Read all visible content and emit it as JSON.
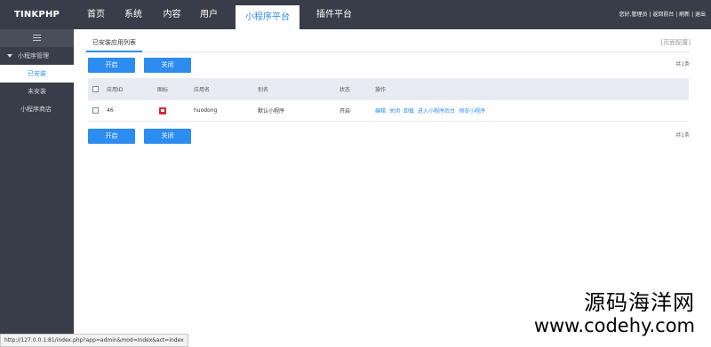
{
  "app": {
    "logo": "TINKPHP"
  },
  "nav": {
    "items": [
      {
        "label": "首页"
      },
      {
        "label": "系统"
      },
      {
        "label": "内容"
      },
      {
        "label": "用户"
      },
      {
        "label": "小程序平台"
      },
      {
        "label": "插件平台"
      }
    ],
    "active_index": 4
  },
  "top_right": "您好,管理员 | 返回前台 | 刷新 | 退出",
  "sidebar": {
    "group_label": "小程序管理",
    "items": [
      {
        "label": "已安装",
        "active": true
      },
      {
        "label": "未安装",
        "active": false
      }
    ],
    "store_label": "小程序商店"
  },
  "content": {
    "tab_label": "已安装应用列表",
    "page_config": "[页面配置]",
    "buttons": {
      "enable": "开启",
      "disable": "关闭"
    },
    "count_text": "共1条"
  },
  "table": {
    "headers": [
      "",
      "应用ID",
      "图标",
      "应用名",
      "别名",
      "状态",
      "操作"
    ],
    "rows": [
      {
        "id": "46",
        "icon": "red-app-icon",
        "name": "huodong",
        "alias": "默认小程序",
        "status": "开启",
        "actions": [
          "编辑",
          "关闭",
          "卸载",
          "进入小程序后台",
          "预览小程序"
        ]
      }
    ]
  },
  "statusbar": "http://127.0.0.1:81/index.php?app=admin&mod=Index&act=index",
  "watermark": {
    "line1": "源码海洋网",
    "line2": "www.codehy.com"
  },
  "colors": {
    "topbar": "#393d49",
    "accent": "#2d8cf0",
    "header_row": "#e8ecf2"
  }
}
